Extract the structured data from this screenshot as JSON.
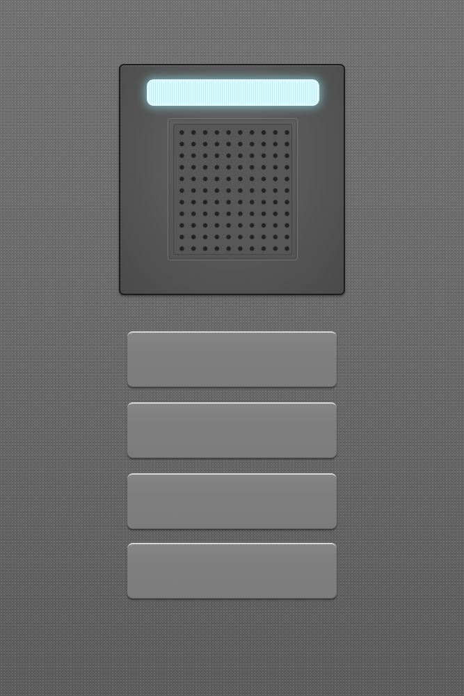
{
  "intercom": {
    "status_light_color": "#dafcfe",
    "panel_color": "#555555",
    "speaker_icon": "speaker-grille-icon"
  },
  "buttons": [
    {
      "label": ""
    },
    {
      "label": ""
    },
    {
      "label": ""
    },
    {
      "label": ""
    }
  ]
}
